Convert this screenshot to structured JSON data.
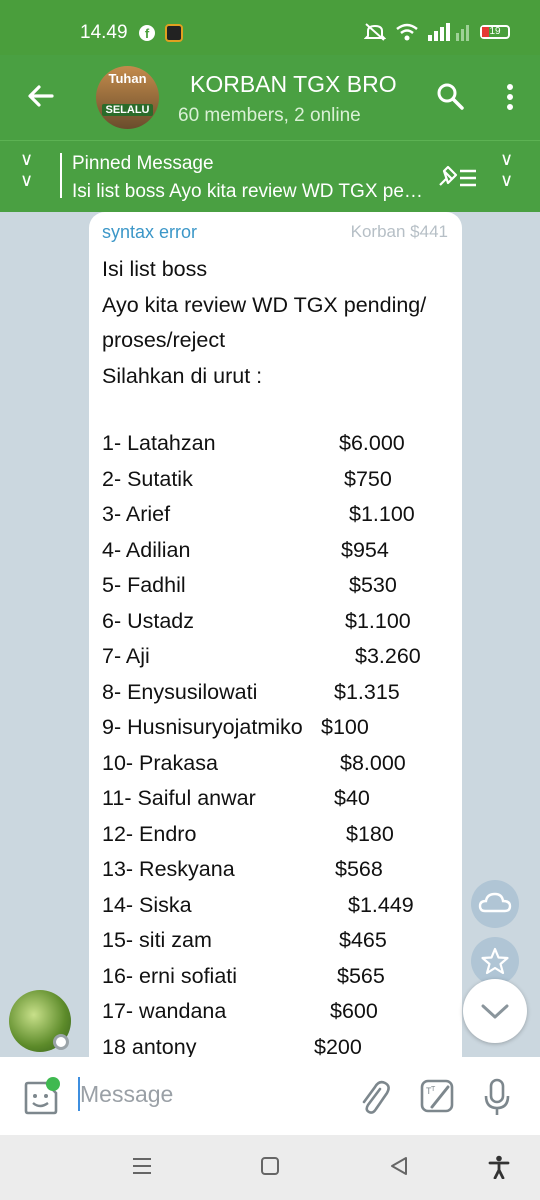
{
  "status_bar": {
    "time": "14.49",
    "battery": "19",
    "icons": [
      "facebook-icon",
      "app-icon",
      "mute-icon",
      "wifi-icon",
      "signal-icon",
      "battery-icon"
    ]
  },
  "header": {
    "title": "KORBAN TGX BRO",
    "subtitle": "60 members, 2 online",
    "avatar_text_top": "Tuhan",
    "avatar_text_bottom": "SELALU"
  },
  "pinned": {
    "label": "Pinned Message",
    "text": "Isi list boss Ayo kita review WD TGX pending/proses/reject"
  },
  "message": {
    "sender": "syntax error",
    "tag": "Korban $441",
    "intro_lines": [
      "Isi list boss",
      "Ayo kita review WD TGX pending/",
      "proses/reject",
      "Silahkan di urut :"
    ],
    "entries": [
      {
        "label": "1- Latahzan",
        "amount": "$6.000"
      },
      {
        "label": "2- Sutatik",
        "amount": "$750"
      },
      {
        "label": "3- Arief",
        "amount": "$1.100"
      },
      {
        "label": "4- Adilian",
        "amount": "$954"
      },
      {
        "label": "5- Fadhil",
        "amount": "$530"
      },
      {
        "label": "6- Ustadz",
        "amount": "$1.100"
      },
      {
        "label": "7- Aji",
        "amount": "$3.260"
      },
      {
        "label": "8- Enysusilowati",
        "amount": "$1.315"
      },
      {
        "label": "9- Husnisuryojatmiko",
        "amount": "$100"
      },
      {
        "label": "10- Prakasa",
        "amount": "$8.000"
      },
      {
        "label": "11- Saiful anwar",
        "amount": "$40"
      },
      {
        "label": "12- Endro",
        "amount": "$180"
      },
      {
        "label": "13- Reskyana",
        "amount": "$568"
      },
      {
        "label": "14- Siska",
        "amount": "$1.449"
      },
      {
        "label": "15- siti zam",
        "amount": "$465"
      },
      {
        "label": "16- erni sofiati",
        "amount": "$565"
      },
      {
        "label": "17- wandana",
        "amount": "$600"
      },
      {
        "label": "18 antony",
        "amount": "$200"
      }
    ]
  },
  "input": {
    "placeholder": "Message"
  },
  "colors": {
    "header_green": "#4aa042",
    "status_green": "#4a9e3c",
    "sender_blue": "#3c97c8",
    "chat_background": "#cbd7df"
  }
}
